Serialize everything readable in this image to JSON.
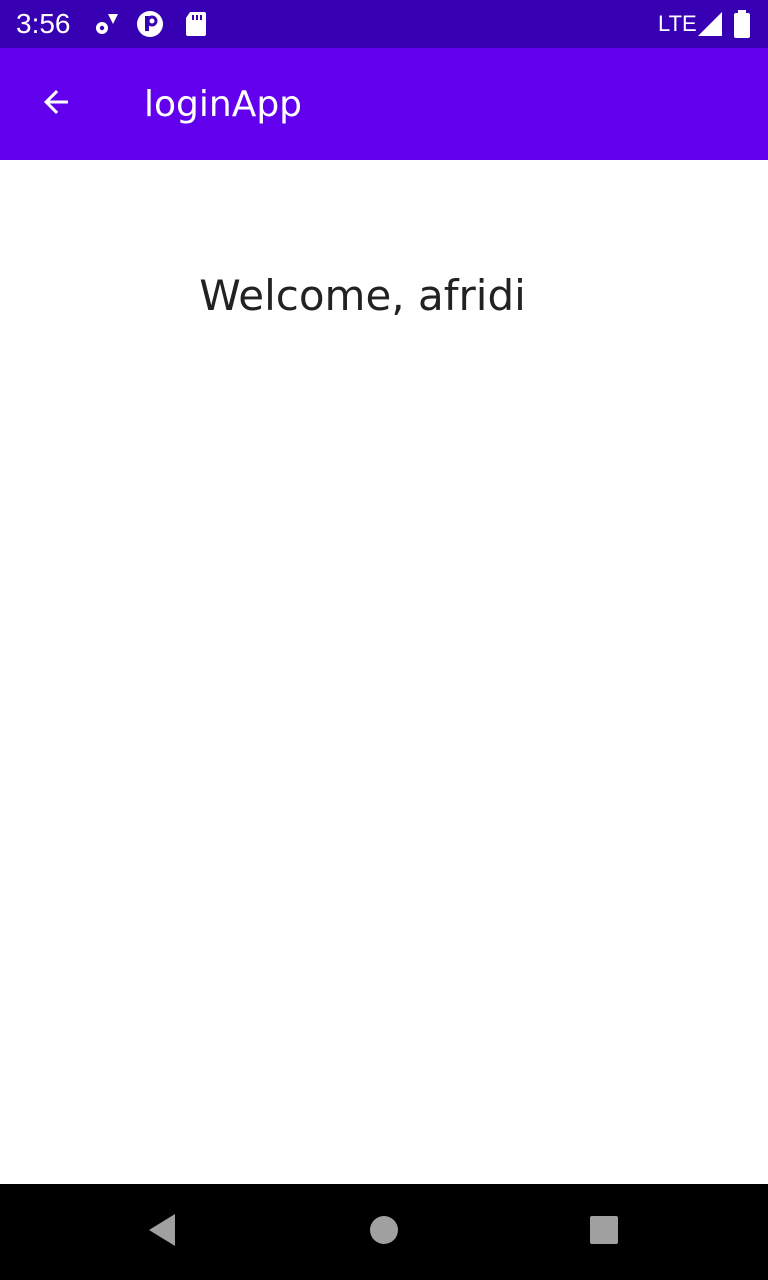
{
  "status_bar": {
    "time": "3:56",
    "network": "LTE",
    "icons": [
      "settings-cog-icon",
      "vpn-key-icon",
      "sd-card-icon",
      "signal-icon",
      "battery-icon"
    ],
    "background_color": "#3700b3"
  },
  "app_bar": {
    "title": "loginApp",
    "back_icon": "arrow-back-icon",
    "background_color": "#6200ee"
  },
  "main": {
    "welcome_text": "Welcome, afridi"
  },
  "nav_bar": {
    "buttons": [
      "back-triangle-icon",
      "home-circle-icon",
      "recents-square-icon"
    ]
  }
}
